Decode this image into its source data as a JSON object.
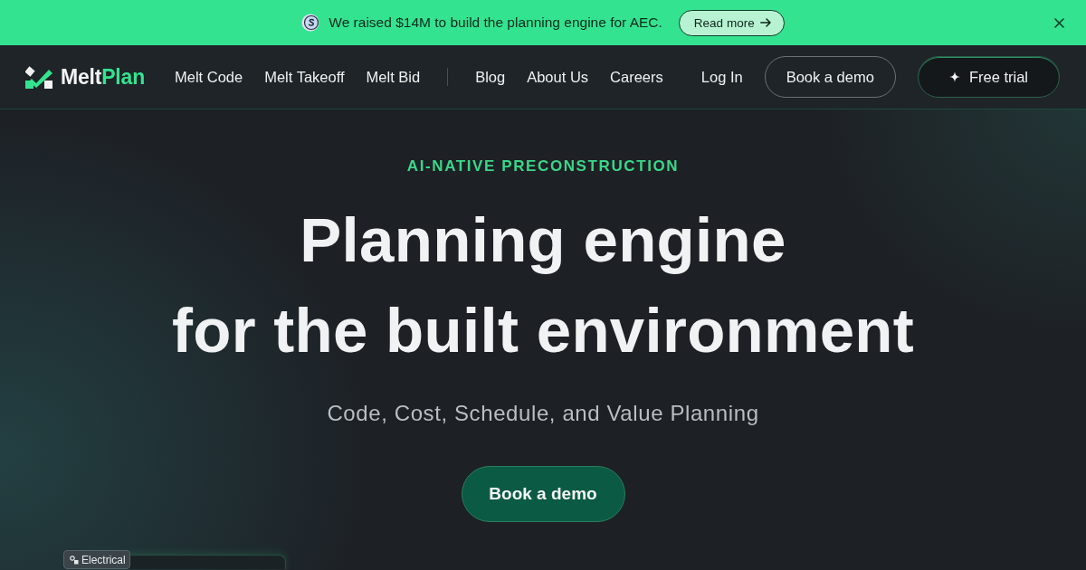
{
  "announcement": {
    "text": "We raised $14M to build the planning engine for AEC.",
    "link": "Read more"
  },
  "nav": {
    "logo": {
      "text": "Melt",
      "accent": "Plan"
    },
    "product_links": [
      "Melt Code",
      "Melt Takeoff",
      "Melt Bid"
    ],
    "company_links": [
      "Blog",
      "About Us",
      "Careers"
    ],
    "login": "Log In",
    "demo_button": "Book a demo",
    "trial_button": "Free trial"
  },
  "hero": {
    "eyebrow": "AI-NATIVE PRECONSTRUCTION",
    "title_lines": [
      "Planning engine",
      "for the built environment"
    ],
    "subtitle": "Code, Cost, Schedule, and Value Planning",
    "cta": "Book a demo"
  },
  "preview_card": {
    "tag": "Electrical"
  }
}
